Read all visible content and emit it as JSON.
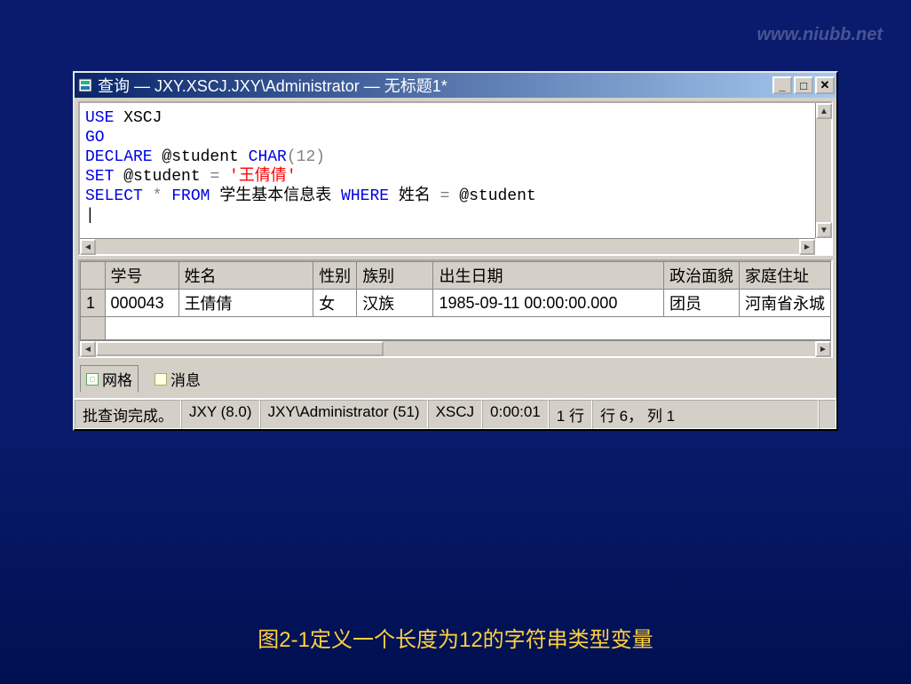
{
  "watermark": "www.niubb.net",
  "window": {
    "title": "查询 — JXY.XSCJ.JXY\\Administrator — 无标题1*"
  },
  "sql": {
    "line1_use": "USE",
    "line1_db": " XSCJ",
    "line2": "GO",
    "line3_declare": "DECLARE",
    "line3_var": " @student ",
    "line3_char": "CHAR",
    "line3_paren": "(12)",
    "line4_set": "SET",
    "line4_assign": " @student ",
    "line4_eq": "=",
    "line4_val": " '王倩倩'",
    "line5_select": "SELECT",
    "line5_star": " * ",
    "line5_from": "FROM",
    "line5_tbl": " 学生基本信息表 ",
    "line5_where": "WHERE",
    "line5_cond": " 姓名 ",
    "line5_eq2": "=",
    "line5_var2": " @student"
  },
  "grid": {
    "headers": {
      "row": "",
      "xh": "学号",
      "xm": "姓名",
      "xb": "性别",
      "zb": "族别",
      "rq": "出生日期",
      "zz": "政治面貌",
      "jt": "家庭住址"
    },
    "row": {
      "num": "1",
      "xh": "000043",
      "xm": "王倩倩",
      "xb": "女",
      "zb": "汉族",
      "rq": "1985-09-11 00:00:00.000",
      "zz": "团员",
      "jt": "河南省永城"
    }
  },
  "tabs": {
    "grid": "网格",
    "msg": "消息"
  },
  "status": {
    "s1": "批查询完成。",
    "s2": "JXY (8.0)",
    "s3": "JXY\\Administrator (51)",
    "s4": "XSCJ",
    "s5": "0:00:01",
    "s6": "1 行",
    "s7": "行 6， 列 1"
  },
  "caption": "图2-1定义一个长度为12的字符串类型变量"
}
